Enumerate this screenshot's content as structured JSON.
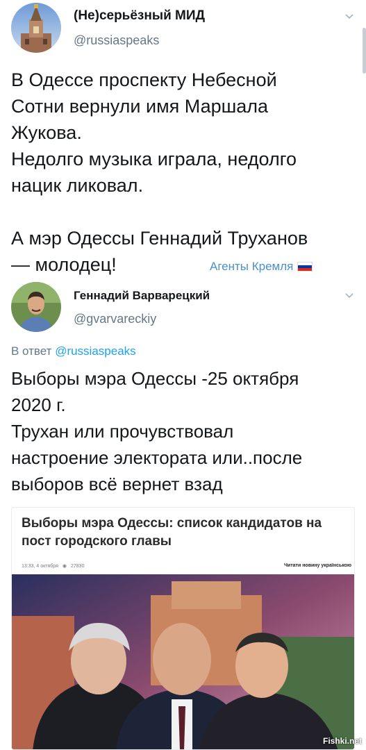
{
  "tweet1": {
    "author_name": "(Не)серьёзный МИД",
    "author_handle": "@russiaspeaks",
    "text": "В Одессе проспекту Небесной\nСотни вернули имя Маршала\nЖукова.\nНедолго музыка играла, недолго\nнацик ликовал.\n\nА мэр Одессы Геннадий Труханов\n— молодец!",
    "signature": "Агенты Кремля",
    "avatar_icon": "kremlin-tower-icon",
    "colors": {
      "signature": "#4a90c9",
      "handle": "#657786"
    }
  },
  "tweet2": {
    "author_name": "Геннадий Варварецкий",
    "author_handle": "@gvarvareckiy",
    "reply_prefix": "В ответ",
    "reply_handle": "@russiaspeaks",
    "text": "Выборы мэра Одессы -25 октября\n2020 г.\nТрухан или прочувствовал\nнастроение электората или..после\nвыборов всё вернет взад",
    "avatar_icon": "person-photo-avatar",
    "colors": {
      "link": "#1da1f2"
    }
  },
  "card": {
    "title": "Выборы мэра Одессы: список кандидатов на пост городского главы",
    "time": "13:33, 4 октября",
    "views": "27830",
    "read_ua": "Читати новину українською",
    "image_icon": "three-politicians-photo"
  },
  "watermark": "Fishki.net"
}
